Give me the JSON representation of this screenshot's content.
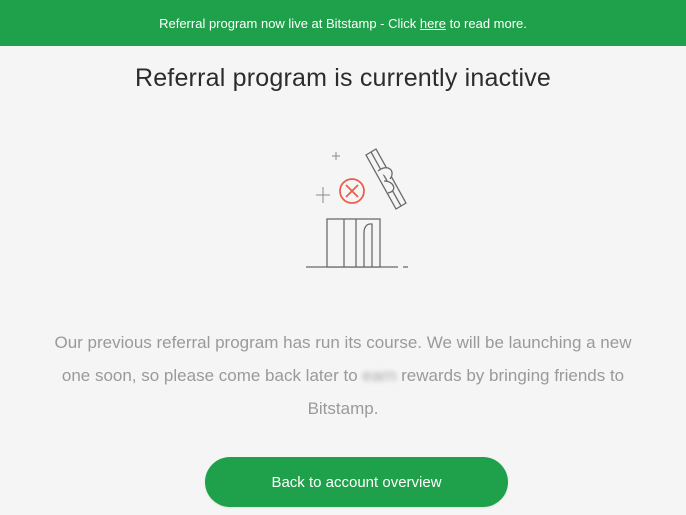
{
  "banner": {
    "text_before": "Referral program now live at Bitstamp - Click ",
    "link_text": "here",
    "text_after": " to read more."
  },
  "page": {
    "title": "Referral program is currently inactive"
  },
  "description": {
    "part1": "Our previous referral program has run its course. We will be launching a new one soon, so please come back later to ",
    "blurred_word": "earn",
    "part2": " rewards by bringing friends to Bitstamp."
  },
  "actions": {
    "back_label": "Back to account overview"
  },
  "icons": {
    "illustration": "gift-box-with-cancelled-ribbon-icon"
  },
  "colors": {
    "brand_green": "#1fa04a",
    "cancel_red": "#e8604c"
  }
}
